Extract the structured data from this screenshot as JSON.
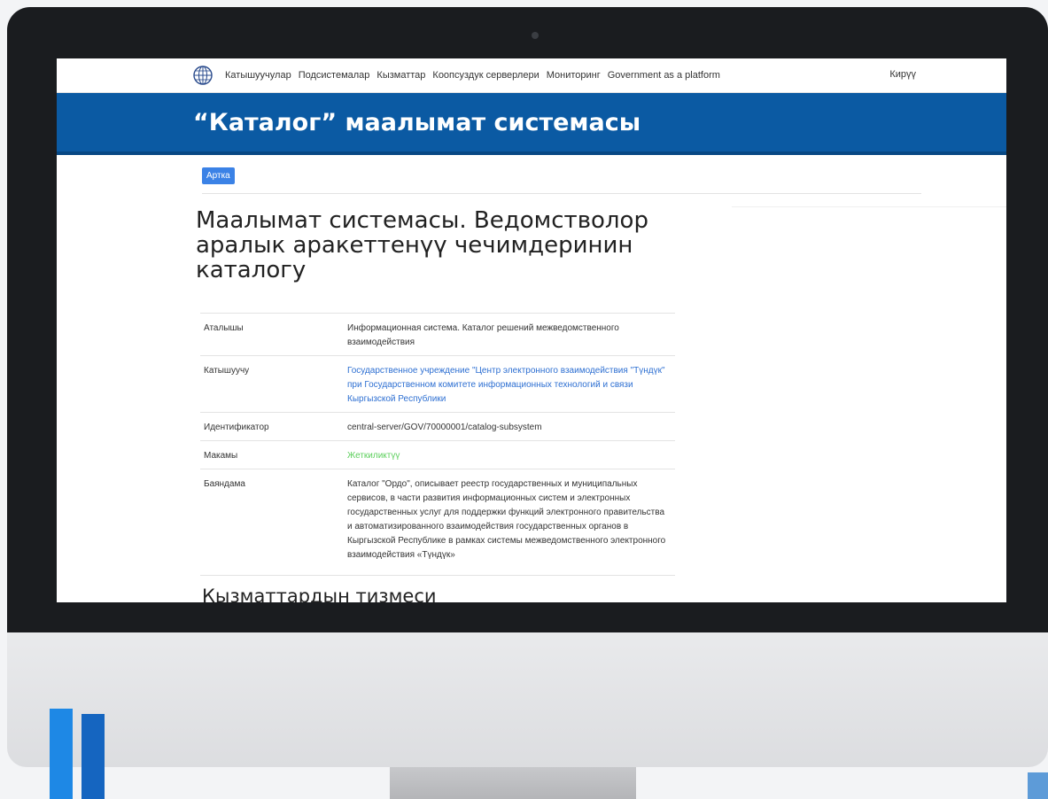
{
  "nav": {
    "items": [
      "Катышуучулар",
      "Подсистемалар",
      "Кызматтар",
      "Коопсуздук серверлери",
      "Мониторинг",
      "Government as a platform"
    ],
    "login": "Кирүү"
  },
  "banner": {
    "title": "“Каталог” маалымат системасы"
  },
  "content": {
    "back_button": "Артка",
    "page_title": "Маалымат системасы. Ведомстволор аралык аракеттенүү чечимдеринин каталогу",
    "rows": [
      {
        "label": "Аталышы",
        "value": "Информационная система. Каталог решений межведомственного взаимодействия"
      },
      {
        "label": "Катышуучу",
        "value": "Государственное учреждение \"Центр электронного взаимодействия \"Түндүк\" при Государственном комитете информационных технологий и связи Кыргызской Республики"
      },
      {
        "label": "Идентификатор",
        "value": "central-server/GOV/70000001/catalog-subsystem"
      },
      {
        "label": "Макамы",
        "value": "Жеткиликтүү"
      },
      {
        "label": "Баяндама",
        "value": "Каталог \"Ордо\", описывает реестр государственных и муниципальных сервисов, в части развития информационных систем и электронных государственных услуг для поддержки функций электронного правительства и автоматизированного взаимодействия государственных органов в Кыргызской Республике в рамках системы межведомственного электронного взаимодействия «Түндүк»"
      }
    ],
    "section_title": "Кызматтардын тизмеси"
  },
  "colors": {
    "banner": "#0b5aa3",
    "link": "#2d6fd2",
    "status": "#5ccf5c",
    "button": "#3b82e6"
  }
}
